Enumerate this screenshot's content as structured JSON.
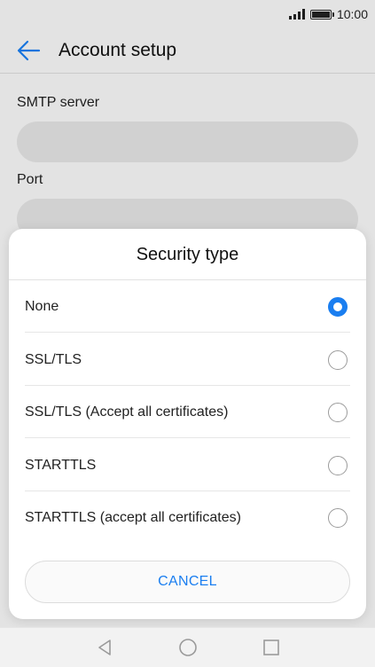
{
  "status_bar": {
    "time": "10:00"
  },
  "app_bar": {
    "title": "Account setup",
    "back_icon": "arrow-left-icon"
  },
  "form": {
    "smtp_server_label": "SMTP server",
    "smtp_server_value": "",
    "port_label": "Port",
    "port_value": ""
  },
  "dialog": {
    "title": "Security type",
    "options": [
      {
        "label": "None",
        "selected": true
      },
      {
        "label": "SSL/TLS",
        "selected": false
      },
      {
        "label": "SSL/TLS (Accept all certificates)",
        "selected": false
      },
      {
        "label": "STARTTLS",
        "selected": false
      },
      {
        "label": "STARTTLS (accept all certificates)",
        "selected": false
      }
    ],
    "cancel_label": "CANCEL"
  },
  "nav_bar": {
    "icons": [
      "back-triangle-icon",
      "home-circle-icon",
      "recents-square-icon"
    ]
  },
  "colors": {
    "accent": "#1a7ef0"
  }
}
